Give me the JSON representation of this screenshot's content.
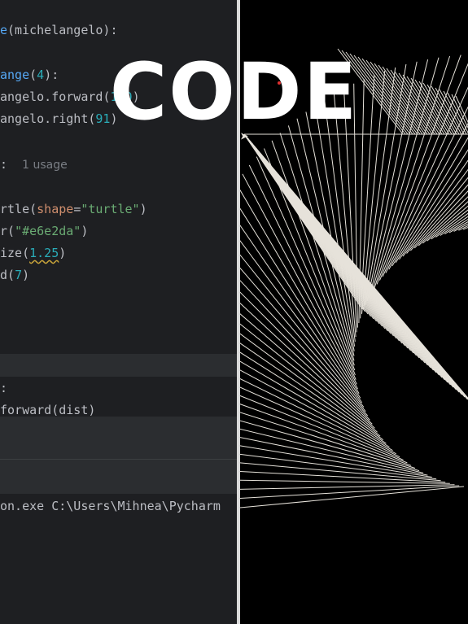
{
  "editor": {
    "lines": {
      "l1_fn": "e",
      "l1_rest": "(michelangelo):",
      "l2_fn": "ange",
      "l2_paren": "(",
      "l2_num": "4",
      "l2_end": "):",
      "l3_a": "angelo.forward",
      "l3_paren": "(",
      "l3_num": "100",
      "l3_end": ")",
      "l4_a": "angelo.right",
      "l4_paren": "(",
      "l4_num": "91",
      "l4_end": ")",
      "l5_colon": ":",
      "l5_hint": "1 usage",
      "l6_a": "rtle(",
      "l6_param": "shape",
      "l6_eq": "=",
      "l6_str": "\"turtle\"",
      "l6_end": ")",
      "l7_a": "r(",
      "l7_str": "\"#e6e2da\"",
      "l7_end": ")",
      "l8_a": "ize(",
      "l8_num": "1.25",
      "l8_end": ")",
      "l9_a": "d(",
      "l9_num": "7",
      "l9_end": ")",
      "l10": ":",
      "l11": "forward(dist)"
    },
    "terminal": "on.exe C:\\Users\\Mihnea\\Pycharm"
  },
  "overlay": {
    "title": "CODE"
  },
  "canvas": {
    "pen_color": "#e6e2da",
    "background": "#000000",
    "turtle_icon": "turtle-arrow-icon"
  }
}
